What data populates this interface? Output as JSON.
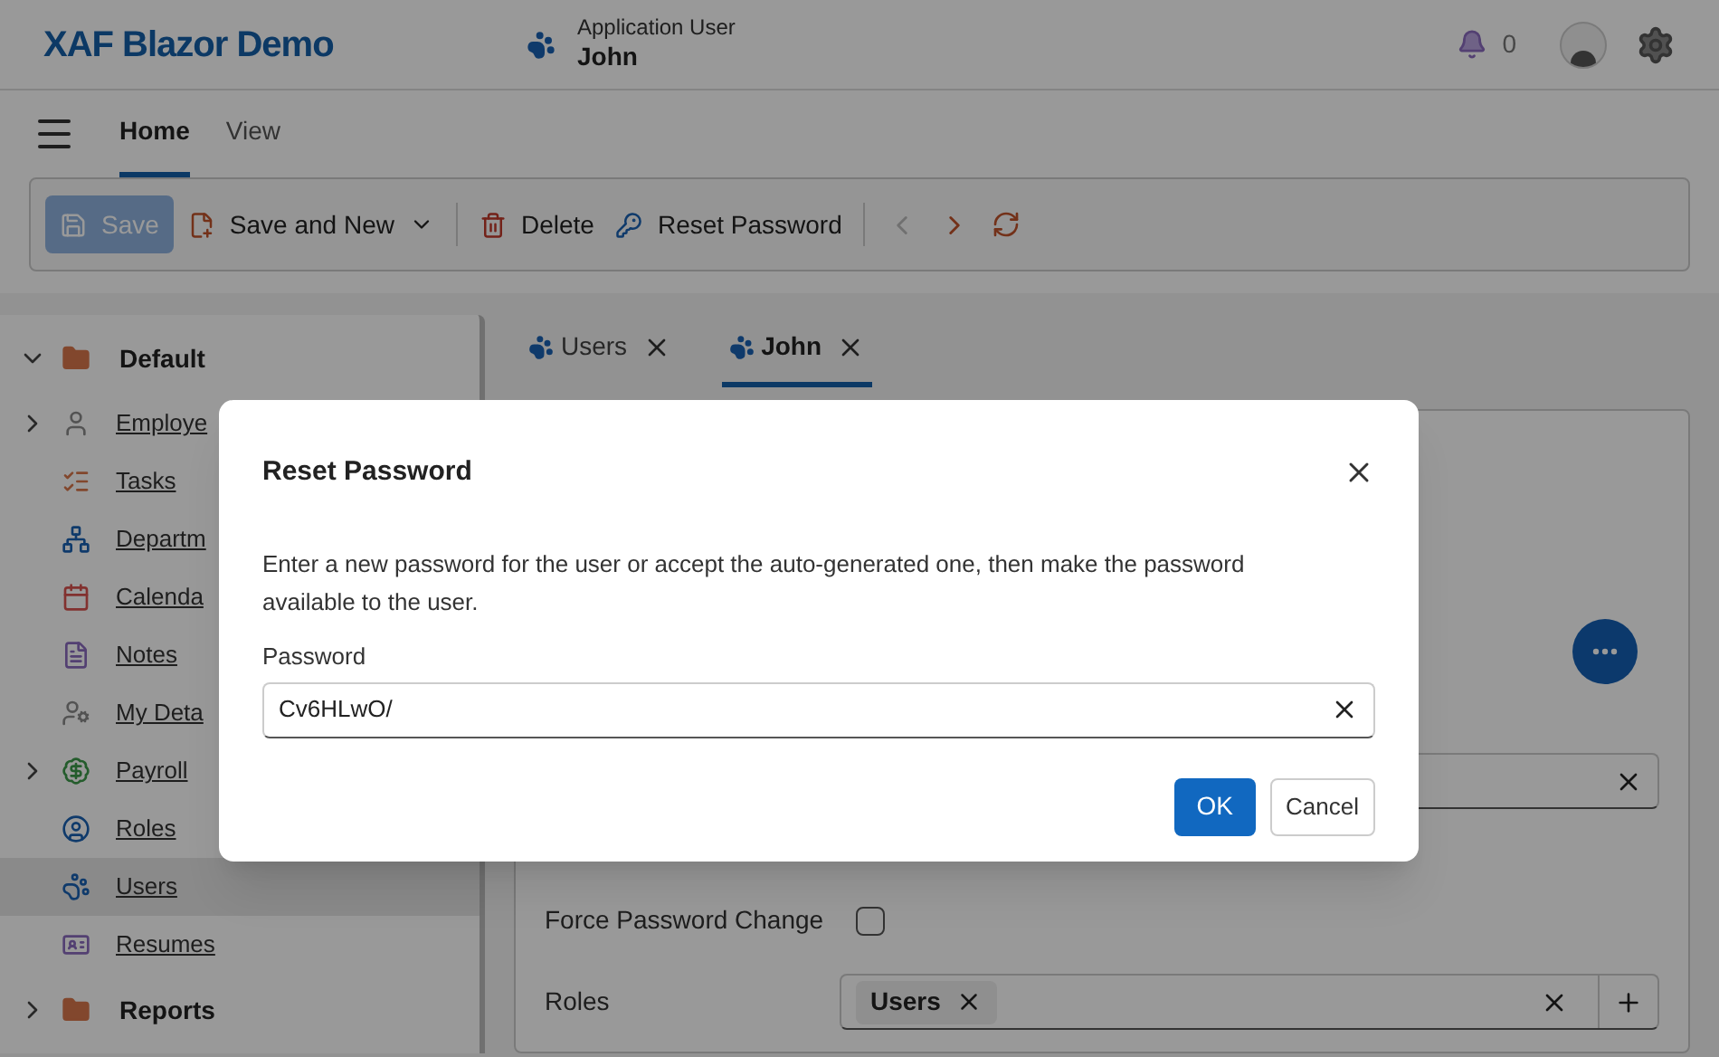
{
  "app": {
    "title": "XAF Blazor Demo"
  },
  "header": {
    "caption": "Application User",
    "user": "John",
    "notifications": "0"
  },
  "ribbon_tabs": [
    {
      "label": "Home",
      "selected": true
    },
    {
      "label": "View",
      "selected": false
    }
  ],
  "toolbar": {
    "save": {
      "label": "Save",
      "disabled": true
    },
    "save_and_new": {
      "label": "Save and New"
    },
    "delete": {
      "label": "Delete"
    },
    "reset_password": {
      "label": "Reset Password"
    },
    "previous": {
      "disabled": true
    },
    "next": {
      "disabled": false
    }
  },
  "navigation": [
    {
      "label": "Default",
      "kind": "group",
      "expanded": true,
      "selected": false,
      "children": [
        {
          "label": "Employe",
          "kind": "branch",
          "expanded": false,
          "selected": false
        },
        {
          "label": "Tasks",
          "kind": "item",
          "selected": false
        },
        {
          "label": "Departm",
          "kind": "item",
          "selected": false
        },
        {
          "label": "Calenda",
          "kind": "item",
          "selected": false
        },
        {
          "label": "Notes",
          "kind": "item",
          "selected": false
        },
        {
          "label": "My Deta",
          "kind": "item",
          "selected": false
        },
        {
          "label": "Payroll",
          "kind": "branch",
          "expanded": false,
          "selected": false
        },
        {
          "label": "Roles",
          "kind": "item",
          "selected": false
        },
        {
          "label": "Users",
          "kind": "item",
          "selected": true
        },
        {
          "label": "Resumes",
          "kind": "item",
          "selected": false
        }
      ]
    },
    {
      "label": "Reports",
      "kind": "group",
      "expanded": false,
      "selected": false
    }
  ],
  "document_tabs": [
    {
      "label": "Users",
      "selected": false
    },
    {
      "label": "John",
      "selected": true
    }
  ],
  "form": [
    {
      "kind": "field"
    },
    {
      "kind": "checkbox",
      "label": "Force Password Change",
      "checked": false
    },
    {
      "kind": "tags",
      "label": "Roles",
      "tags": [
        "Users"
      ]
    }
  ],
  "dialog": {
    "title": "Reset Password",
    "message": "Enter a new password for the user or accept the auto-generated one, then make the password available to the user.",
    "field_label": "Password",
    "value": "Cv6HLwO/",
    "ok": "OK",
    "cancel": "Cancel"
  }
}
